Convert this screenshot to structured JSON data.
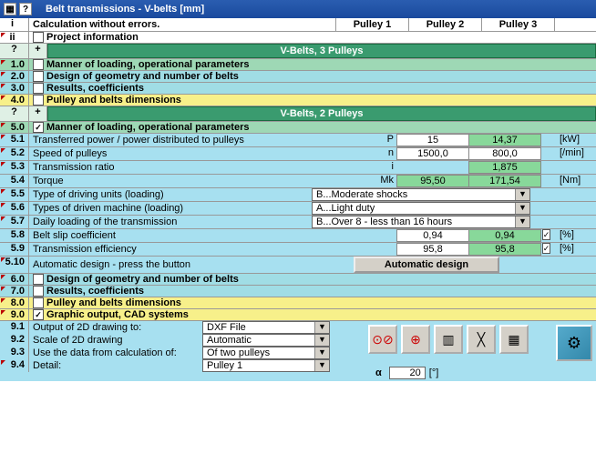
{
  "title": "Belt transmissions - V-belts [mm]",
  "hdr": {
    "i": "i",
    "status": "Calculation without errors.",
    "p1": "Pulley 1",
    "p2": "Pulley 2",
    "p3": "Pulley 3",
    "ii": "ii",
    "proj": "Project information"
  },
  "band3": "V-Belts, 3 Pulleys",
  "band2": "V-Belts, 2 Pulleys",
  "s3": {
    "n10": "1.0",
    "t10": "Manner of loading, operational parameters",
    "n20": "2.0",
    "t20": "Design of geometry and number of belts",
    "n30": "3.0",
    "t30": "Results, coefficients",
    "n40": "4.0",
    "t40": "Pulley and belts dimensions"
  },
  "s5": {
    "n": "5.0",
    "t": "Manner of loading, operational parameters",
    "r1": {
      "n": "5.1",
      "lbl": "Transferred power / power distributed to pulleys",
      "sym": "P",
      "v1": "15",
      "v2": "14,37",
      "u": "[kW]"
    },
    "r2": {
      "n": "5.2",
      "lbl": "Speed of pulleys",
      "sym": "n",
      "v1": "1500,0",
      "v2": "800,0",
      "u": "[/min]"
    },
    "r3": {
      "n": "5.3",
      "lbl": "Transmission ratio",
      "sym": "i",
      "v2": "1,875"
    },
    "r4": {
      "n": "5.4",
      "lbl": "Torque",
      "sym": "Mk",
      "v1": "95,50",
      "v2": "171,54",
      "u": "[Nm]"
    },
    "r5": {
      "n": "5.5",
      "lbl": "Type of driving units (loading)",
      "dd": "B...Moderate shocks"
    },
    "r6": {
      "n": "5.6",
      "lbl": "Types of driven machine (loading)",
      "dd": "A...Light duty"
    },
    "r7": {
      "n": "5.7",
      "lbl": "Daily loading of the transmission",
      "dd": "B...Over 8 - less than 16 hours"
    },
    "r8": {
      "n": "5.8",
      "lbl": "Belt slip coefficient",
      "v1": "0,94",
      "v2": "0,94",
      "u": "[%]"
    },
    "r9": {
      "n": "5.9",
      "lbl": "Transmission efficiency",
      "v1": "95,8",
      "v2": "95,8",
      "u": "[%]"
    },
    "r10": {
      "n": "5.10",
      "lbl": "Automatic design - press the button",
      "btn": "Automatic design"
    }
  },
  "s2": {
    "n60": "6.0",
    "t60": "Design of geometry and number of belts",
    "n70": "7.0",
    "t70": "Results, coefficients",
    "n80": "8.0",
    "t80": "Pulley and belts dimensions",
    "n90": "9.0",
    "t90": "Graphic output, CAD systems"
  },
  "s9": {
    "r1": {
      "n": "9.1",
      "lbl": "Output of 2D drawing to:",
      "dd": "DXF File"
    },
    "r2": {
      "n": "9.2",
      "lbl": "Scale of 2D drawing",
      "dd": "Automatic"
    },
    "r3": {
      "n": "9.3",
      "lbl": "Use the data from calculation of:",
      "dd": "Of two pulleys"
    },
    "r4": {
      "n": "9.4",
      "lbl": "Detail:",
      "dd": "Pulley 1"
    },
    "alpha_sym": "α",
    "alpha": "20",
    "alpha_u": "[°]"
  },
  "q": "?",
  "plus": "+",
  "check": "✓"
}
